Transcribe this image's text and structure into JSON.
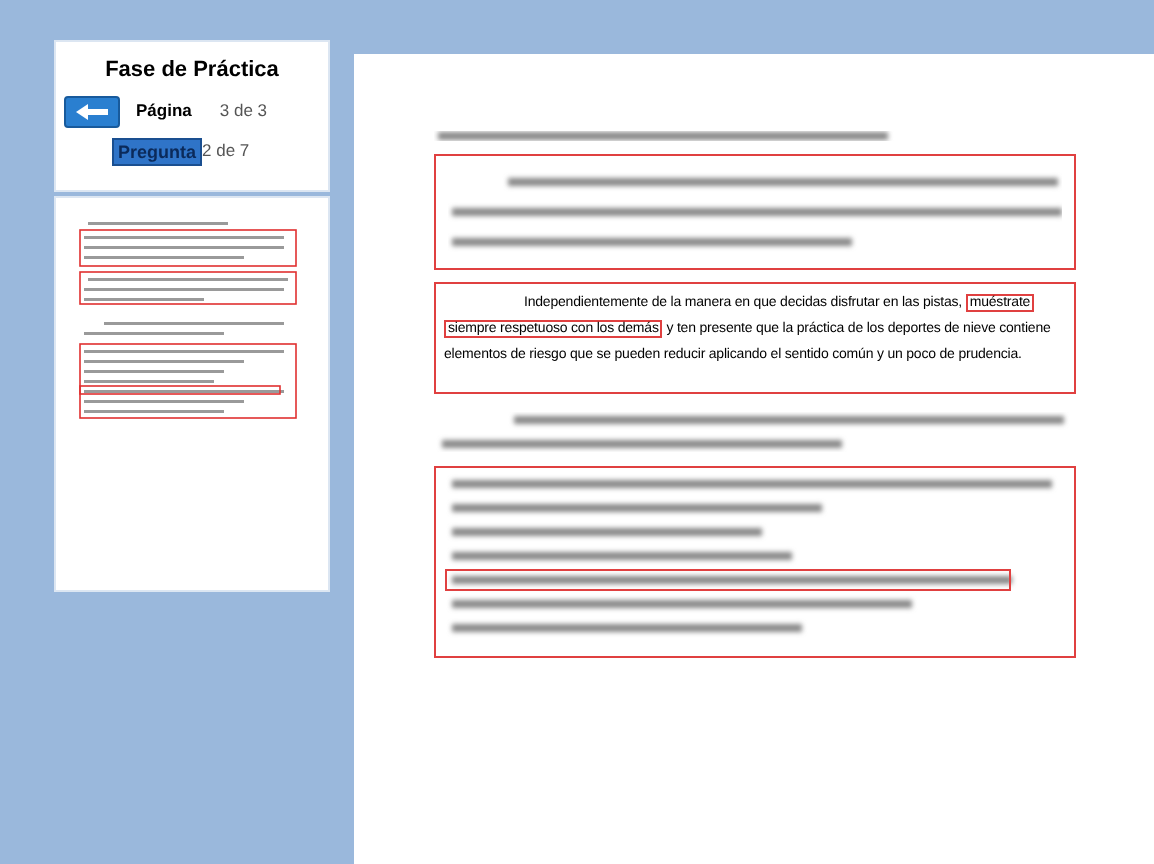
{
  "panel": {
    "title": "Fase de Práctica",
    "page_label": "Página",
    "page_value": "3 de 3",
    "question_button": "Pregunta",
    "question_value": "2 de 7"
  },
  "document": {
    "paragraph": [
      {
        "text": "Independientemente de la manera en que decidas disfrutar en las pistas,",
        "marked": false
      },
      {
        "text": "muéstrate",
        "marked": true
      },
      {
        "text": "siempre respetuoso con los demás",
        "marked": true
      },
      {
        "text": "y ten presente que la práctica de los deportes de  nieve contiene elementos de riesgo que se pueden reducir aplicando el sentido común y un poco de prudencia.",
        "marked": false
      }
    ]
  }
}
